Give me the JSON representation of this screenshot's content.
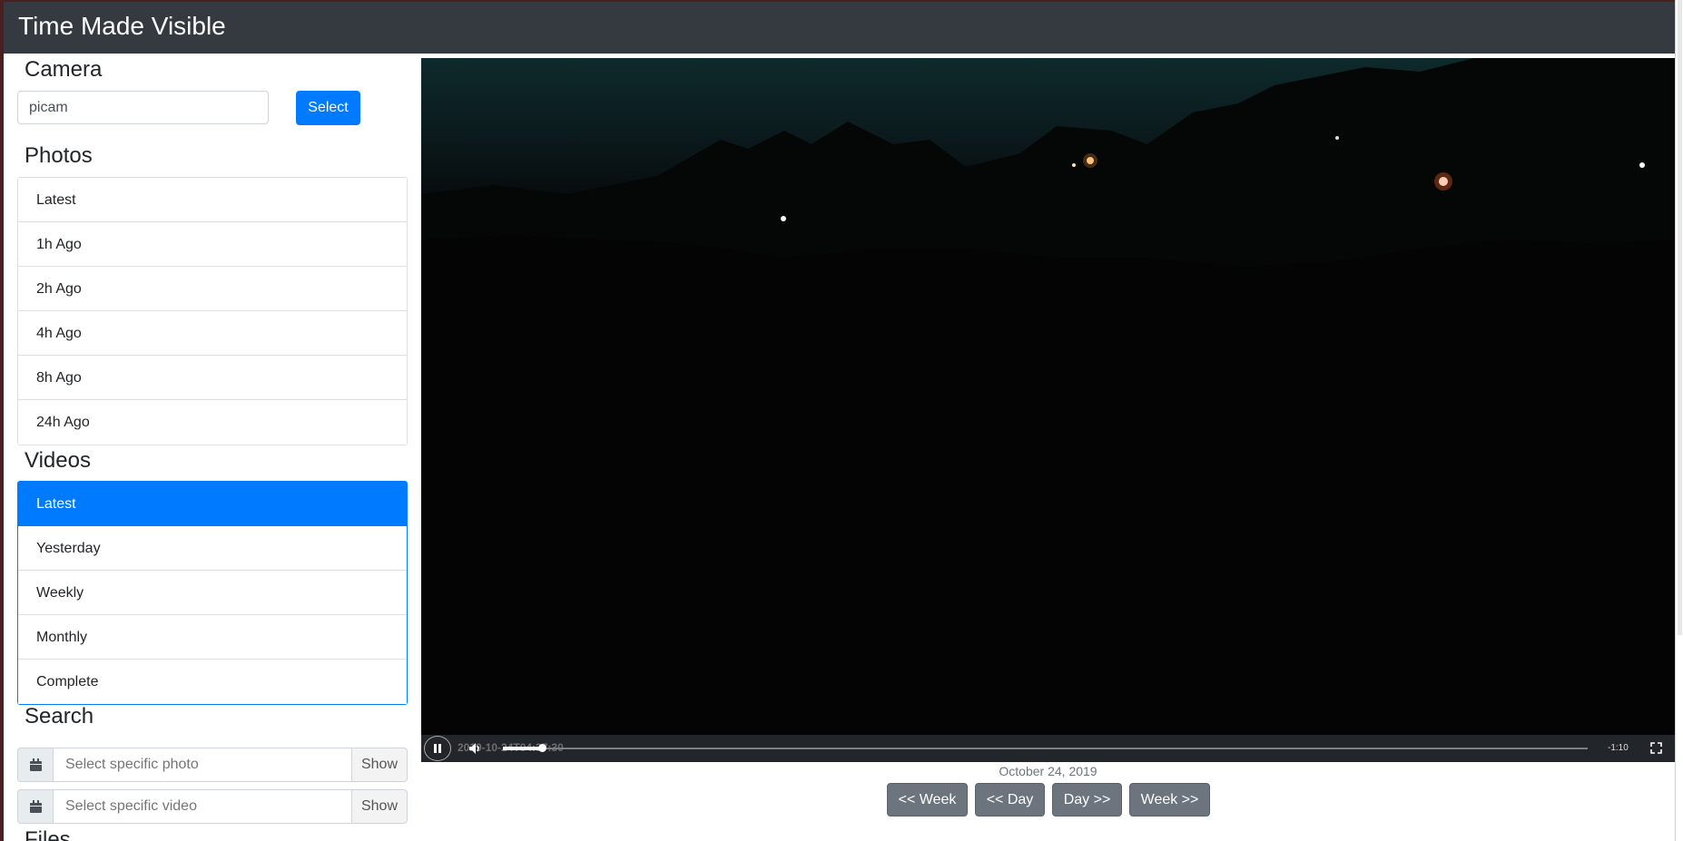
{
  "app": {
    "title": "Time Made Visible"
  },
  "camera": {
    "heading": "Camera",
    "value": "picam",
    "select_label": "Select"
  },
  "photos": {
    "heading": "Photos",
    "items": [
      {
        "label": "Latest"
      },
      {
        "label": "1h Ago"
      },
      {
        "label": "2h Ago"
      },
      {
        "label": "4h Ago"
      },
      {
        "label": "8h Ago"
      },
      {
        "label": "24h Ago"
      }
    ]
  },
  "videos": {
    "heading": "Videos",
    "items": [
      {
        "label": "Latest",
        "active": true
      },
      {
        "label": "Yesterday"
      },
      {
        "label": "Weekly"
      },
      {
        "label": "Monthly"
      },
      {
        "label": "Complete"
      }
    ]
  },
  "search": {
    "heading": "Search",
    "photo_placeholder": "Select specific photo",
    "video_placeholder": "Select specific video",
    "show_label": "Show"
  },
  "files": {
    "heading": "Files"
  },
  "player": {
    "timestamp": "2019-10-24T04:37:30",
    "remaining": "-1:10",
    "progress": 0.036
  },
  "date_label": "October 24, 2019",
  "nav": {
    "prev_week": "<< Week",
    "prev_day": "<< Day",
    "next_day": "Day >>",
    "next_week": "Week >>"
  },
  "colors": {
    "primary": "#007bff",
    "navbar": "#343a40",
    "secondary": "#6c757d"
  }
}
